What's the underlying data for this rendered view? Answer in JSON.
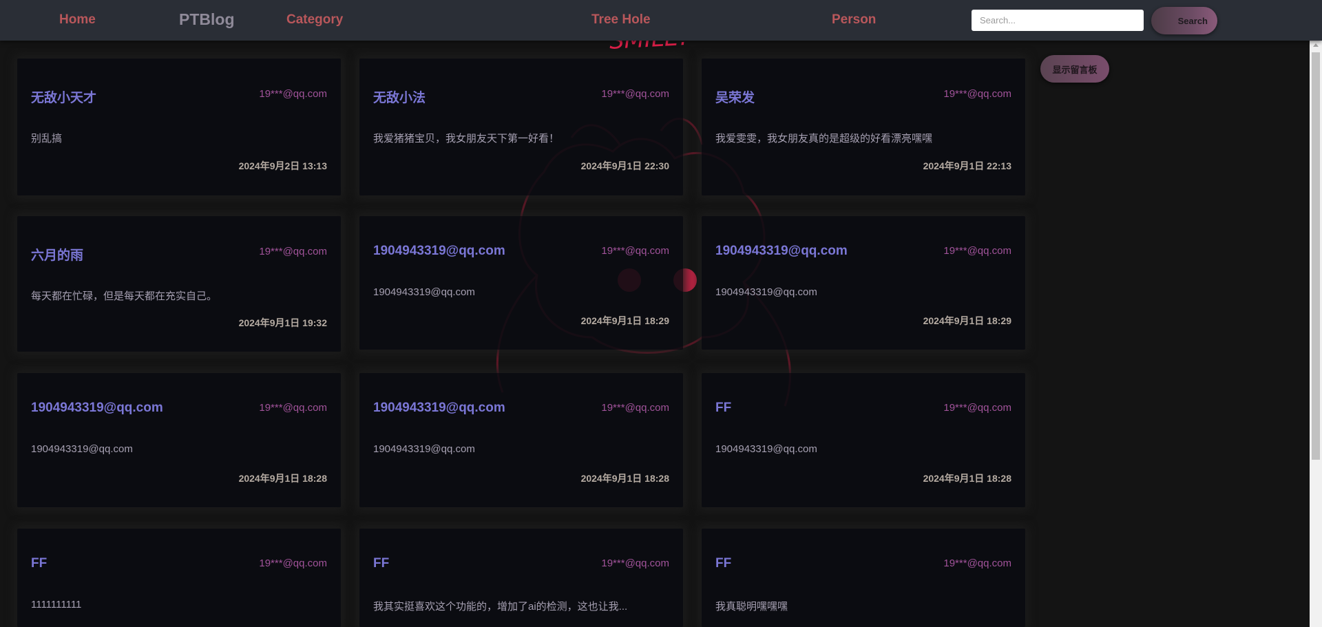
{
  "nav": {
    "home": "Home",
    "brand": "PTBlog",
    "category": "Category",
    "tree_hole": "Tree Hole",
    "person": "Person",
    "search_placeholder": "Search...",
    "search_button": "Search"
  },
  "sidebar": {
    "board_button": "显示留言板"
  },
  "background": {
    "art_text": "SMILE!",
    "accent_color": "#e0204a"
  },
  "cards": [
    {
      "title": "无敌小天才",
      "email": "19***@qq.com",
      "content": "别乱搞",
      "date": "2024年9月2日 13:13"
    },
    {
      "title": "无敌小法",
      "email": "19***@qq.com",
      "content": "我爱猪猪宝贝，我女朋友天下第一好看！",
      "date": "2024年9月1日 22:30"
    },
    {
      "title": "吴荣发",
      "email": "19***@qq.com",
      "content": "我爱雯雯，我女朋友真的是超级的好看漂亮嘿嘿",
      "date": "2024年9月1日 22:13"
    },
    {
      "title": "六月的雨",
      "email": "19***@qq.com",
      "content": "每天都在忙碌，但是每天都在充实自己。",
      "date": "2024年9月1日 19:32"
    },
    {
      "title": "1904943319@qq.com",
      "email": "19***@qq.com",
      "content": "1904943319@qq.com",
      "date": "2024年9月1日 18:29"
    },
    {
      "title": "1904943319@qq.com",
      "email": "19***@qq.com",
      "content": "1904943319@qq.com",
      "date": "2024年9月1日 18:29"
    },
    {
      "title": "1904943319@qq.com",
      "email": "19***@qq.com",
      "content": "1904943319@qq.com",
      "date": "2024年9月1日 18:28"
    },
    {
      "title": "1904943319@qq.com",
      "email": "19***@qq.com",
      "content": "1904943319@qq.com",
      "date": "2024年9月1日 18:28"
    },
    {
      "title": "FF",
      "email": "19***@qq.com",
      "content": "1904943319@qq.com",
      "date": "2024年9月1日 18:28"
    },
    {
      "title": "FF",
      "email": "19***@qq.com",
      "content": "1111111111",
      "date": ""
    },
    {
      "title": "FF",
      "email": "19***@qq.com",
      "content": "我其实挺喜欢这个功能的，增加了ai的检测，这也让我...",
      "date": ""
    },
    {
      "title": "FF",
      "email": "19***@qq.com",
      "content": "我真聪明嘿嘿嘿",
      "date": ""
    }
  ]
}
